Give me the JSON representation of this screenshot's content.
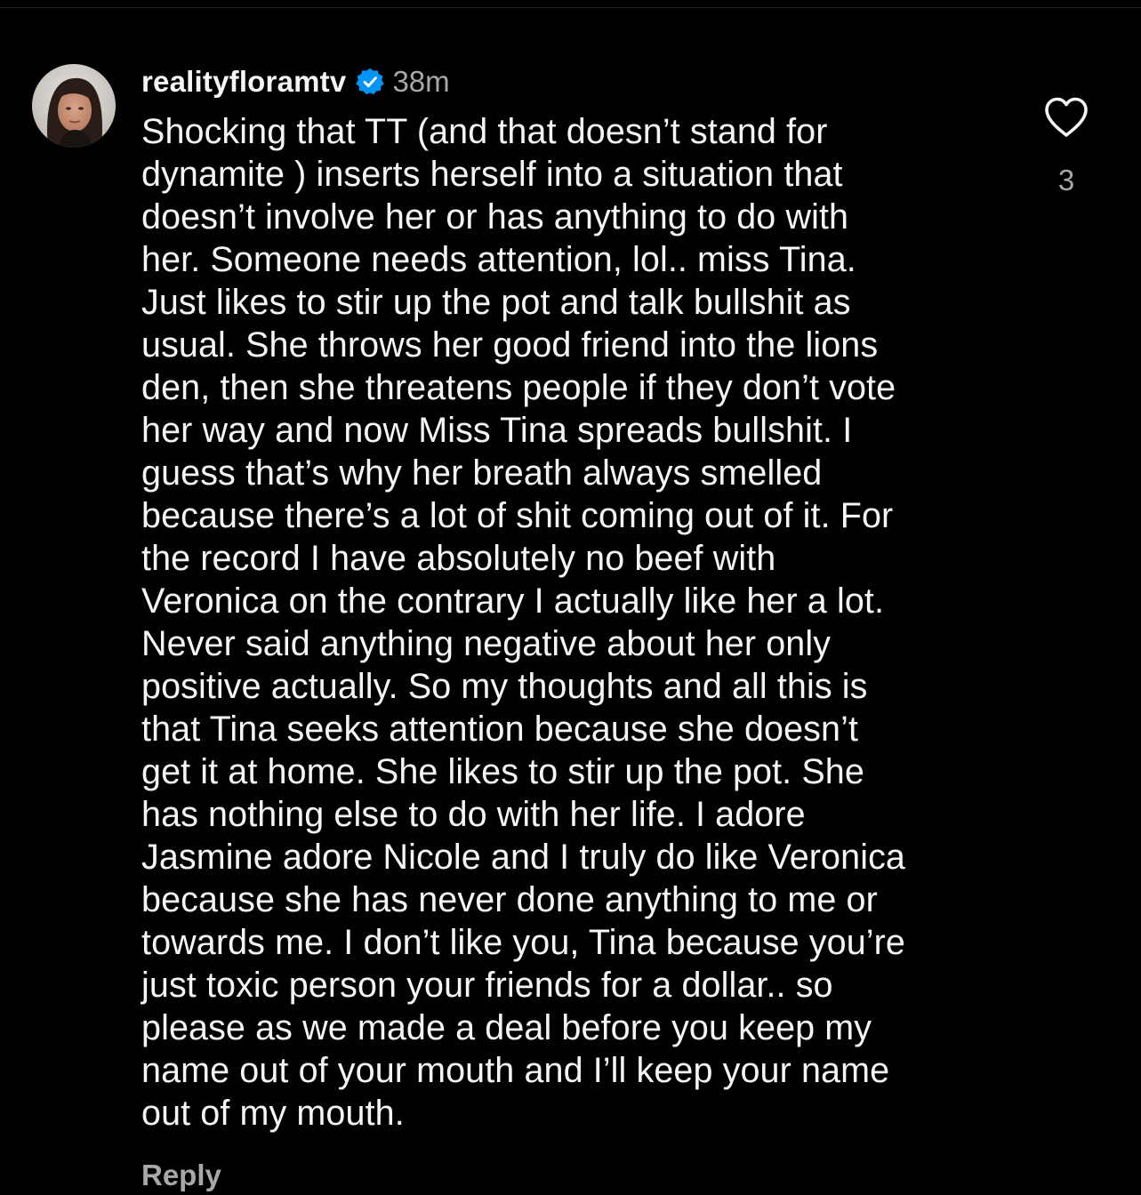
{
  "comment": {
    "username": "realityfloramtv",
    "verified_icon": "verified-badge-icon",
    "timestamp": "38m",
    "text": "Shocking that TT (and that doesn’t stand for\ndynamite ) inserts herself into a situation that\ndoesn’t involve her or has anything to do with\nher. Someone needs attention, lol.. miss Tina.\nJust likes to stir up the pot and talk bullshit as\nusual. She throws her good friend into the lions\nden, then she threatens people if they don’t vote\nher way and now Miss Tina spreads bullshit. I\nguess that’s why her breath always smelled\nbecause there’s a lot of shit coming out of it. For\nthe record I have absolutely no beef with\nVeronica on the contrary I actually like her a lot.\nNever said anything negative about her only\npositive actually.  So my thoughts and all this is\nthat Tina seeks attention because she doesn’t\nget it at home. She likes to stir up the pot. She\nhas nothing else to do with her life. I adore\nJasmine adore Nicole and I truly do like Veronica\nbecause she has never done anything to me or\ntowards me. I don’t like you, Tina because you’re\njust toxic person your friends for a dollar.. so\nplease as we made a deal before you keep my\nname out of your mouth and I’ll keep your name\nout of my mouth.",
    "like_count": "3",
    "like_icon": "heart-outline-icon",
    "reply_label": "Reply"
  },
  "colors": {
    "background": "#000000",
    "primary_text": "#f5f5f5",
    "secondary_text": "#a8a8a8",
    "verified_badge": "#0095f6"
  }
}
